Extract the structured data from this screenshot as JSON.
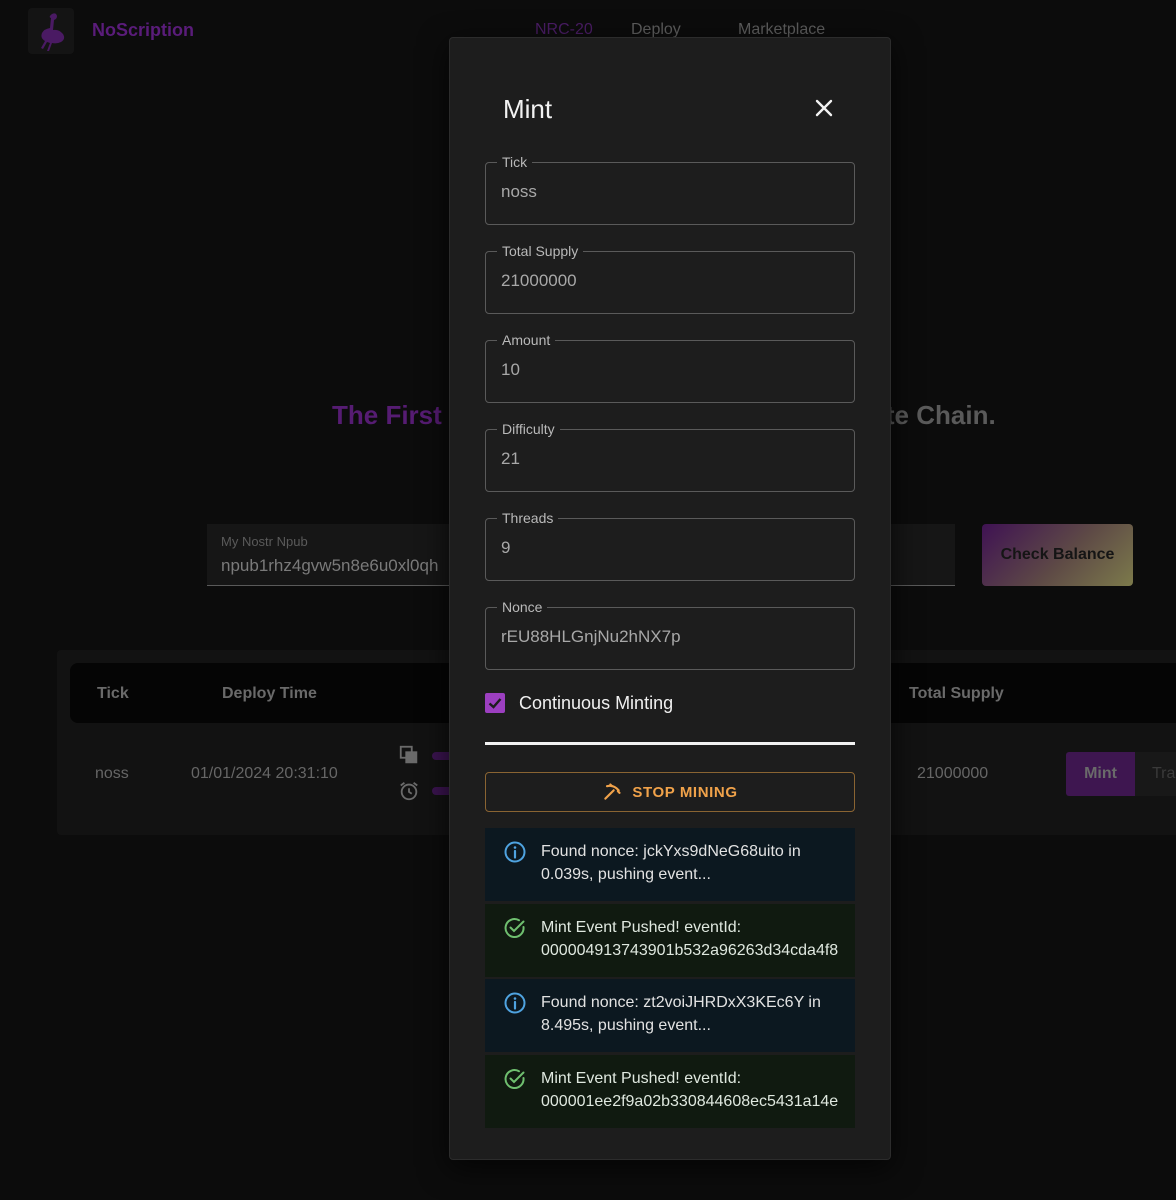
{
  "header": {
    "brand": "NoScription",
    "nav": {
      "nrc": "NRC-20",
      "deploy": "Deploy",
      "marketplace": "Marketplace"
    }
  },
  "hero": {
    "left": "The First",
    "right": "ote Chain."
  },
  "npub": {
    "label": "My Nostr Npub",
    "value": "npub1rhz4gvw5n8e6u0xl0qh"
  },
  "check_balance": "Check Balance",
  "table": {
    "headers": {
      "tick": "Tick",
      "deploy_time": "Deploy Time",
      "total_supply": "Total Supply"
    },
    "row": {
      "tick": "noss",
      "deploy_time": "01/01/2024 20:31:10",
      "total_supply": "21000000",
      "mint": "Mint",
      "transfer": "Tra"
    }
  },
  "modal": {
    "title": "Mint",
    "fields": {
      "tick": {
        "label": "Tick",
        "value": "noss"
      },
      "total_supply": {
        "label": "Total Supply",
        "value": "21000000"
      },
      "amount": {
        "label": "Amount",
        "value": "10"
      },
      "difficulty": {
        "label": "Difficulty",
        "value": "21"
      },
      "threads": {
        "label": "Threads",
        "value": "9"
      },
      "nonce": {
        "label": "Nonce",
        "value": "rEU88HLGnjNu2hNX7p"
      }
    },
    "continuous_minting": {
      "label": "Continuous Minting",
      "checked": true
    },
    "stop_button": "STOP MINING",
    "alerts": [
      {
        "type": "info",
        "text": "Found nonce: jckYxs9dNeG68uito in\n0.039s, pushing event..."
      },
      {
        "type": "success",
        "text": "Mint Event Pushed! eventId:\n000004913743901b532a96263d34cda4f8"
      },
      {
        "type": "info",
        "text": "Found nonce: zt2voiJHRDxX3KEc6Y in\n8.495s, pushing event..."
      },
      {
        "type": "success",
        "text": "Mint Event Pushed! eventId:\n000001ee2f9a02b330844608ec5431a14e"
      }
    ]
  },
  "colors": {
    "accent": "#9c3fc0",
    "warning": "#f0a24a",
    "info": "#4fa3e0",
    "success": "#6fbf6f"
  }
}
